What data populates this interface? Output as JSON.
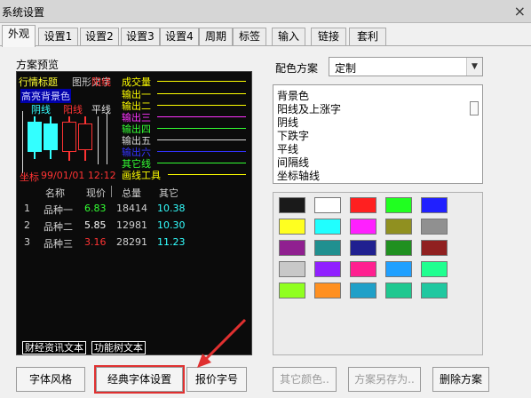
{
  "window": {
    "title": "系统设置",
    "close_label": "×"
  },
  "tabs": [
    {
      "label": "外观",
      "active": true
    },
    {
      "label": "设置1"
    },
    {
      "label": "设置2"
    },
    {
      "label": "设置3"
    },
    {
      "label": "设置4"
    },
    {
      "label": "周期"
    },
    {
      "label": "标签"
    },
    {
      "label": "输入"
    },
    {
      "label": "链接"
    },
    {
      "label": "套利"
    }
  ],
  "preview": {
    "section_label": "方案预览",
    "header": {
      "title": "行情标题",
      "font_text": "图形文字"
    },
    "bg_label": "高亮背景色",
    "up_label": "阴线",
    "down_label": "阳线",
    "flat_label": "平线",
    "legend": [
      {
        "label": "成交量",
        "color": "#ffff00"
      },
      {
        "label": "输出一",
        "color": "#ffff00"
      },
      {
        "label": "输出二",
        "color": "#ffff00"
      },
      {
        "label": "输出三",
        "color": "#ff33ff"
      },
      {
        "label": "输出四",
        "color": "#33ff33"
      },
      {
        "label": "输出五",
        "color": "#d9d9d9"
      },
      {
        "label": "输出六",
        "color": "#3333ff"
      },
      {
        "label": "其它线",
        "color": "#33ff33"
      },
      {
        "label": "画线工具",
        "color": "#ffff00"
      }
    ],
    "coord": {
      "label": "坐标",
      "value": "99/01/01 12:12"
    },
    "table": {
      "headers": [
        "名称",
        "现价",
        "总量",
        "其它"
      ],
      "rows": [
        {
          "idx": "1",
          "name": "品种一",
          "price": "6.83",
          "volume": "18414",
          "other": "10.38",
          "price_color": "#33ff33"
        },
        {
          "idx": "2",
          "name": "品种二",
          "price": "5.85",
          "volume": "12981",
          "other": "10.30",
          "price_color": "#ffffff"
        },
        {
          "idx": "3",
          "name": "品种三",
          "price": "3.16",
          "volume": "28291",
          "other": "11.23",
          "price_color": "#ff3333"
        }
      ]
    },
    "footer_left": "财经资讯文本",
    "footer_right": "功能树文本"
  },
  "scheme": {
    "label": "配色方案",
    "selected": "定制",
    "items": [
      "背景色",
      "阳线及上涨字",
      "阴线",
      "下跌字",
      "平线",
      "间隔线",
      "坐标轴线"
    ]
  },
  "palette": {
    "colors": [
      "#1a1a1a",
      "#ffffff",
      "#ff2020",
      "#20ff20",
      "#2020ff",
      "#ffff20",
      "#20ffff",
      "#ff20ff",
      "#909020",
      "#909090",
      "#902090",
      "#209090",
      "#202090",
      "#209020",
      "#902020",
      "#c8c8c8",
      "#9020ff",
      "#ff2090",
      "#20a0ff",
      "#20ff90",
      "#90ff20",
      "#ff9020",
      "#20a0c8",
      "#20c890",
      "#20c8a0"
    ]
  },
  "buttons": {
    "font_style": "字体风格",
    "classic_font": "经典字体设置",
    "quote_font": "报价字号",
    "other_color": "其它颜色..",
    "save_as": "方案另存为..",
    "delete": "删除方案"
  }
}
